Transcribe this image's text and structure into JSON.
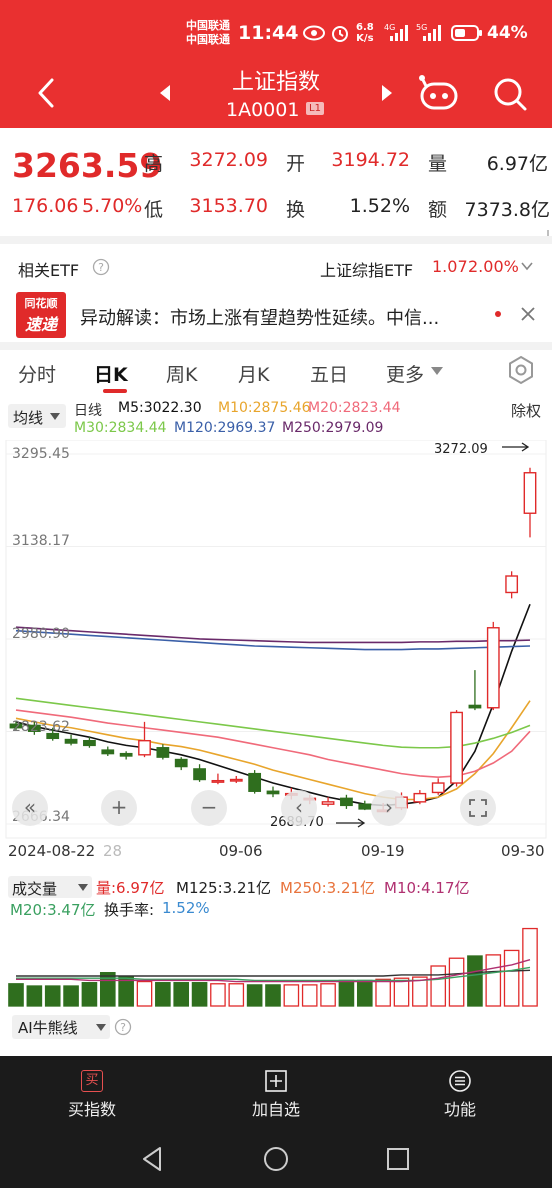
{
  "status_bar": {
    "carrier1": "中国联通",
    "carrier2": "中国联通",
    "time": "11:44",
    "net_speed_top": "6.8",
    "net_speed_bottom": "K/s",
    "battery": "44%"
  },
  "header": {
    "title": "上证指数",
    "code": "1A0001",
    "badge": "L1"
  },
  "quote": {
    "price": "3263.59",
    "change": "176.06",
    "change_pct": "5.70%",
    "high_label": "高",
    "high": "3272.09",
    "open_label": "开",
    "open": "3194.72",
    "volume_label": "量",
    "volume": "6.97亿",
    "low_label": "低",
    "low": "3153.70",
    "turnover_label": "换",
    "turnover": "1.52%",
    "amount_label": "额",
    "amount": "7373.8亿"
  },
  "etf": {
    "label": "相关ETF",
    "name": "上证综指ETF",
    "price": "1.07",
    "pct": "2.00%"
  },
  "news": {
    "logo_top": "同花顺",
    "logo_bottom": "速递",
    "text": "异动解读：市场上涨有望趋势性延续。中信..."
  },
  "tabs": [
    "分时",
    "日K",
    "周K",
    "月K",
    "五日",
    "更多"
  ],
  "chart_header": {
    "ma_select": "均线",
    "period": "日线",
    "m5": "M5:3022.30",
    "m10": "M10:2875.46",
    "m20": "M20:2823.44",
    "m30": "M30:2834.44",
    "m120": "M120:2969.37",
    "m250": "M250:2979.09",
    "adjust": "除权"
  },
  "volume_header": {
    "select": "成交量",
    "vol": "量:6.97亿",
    "m125": "M125:3.21亿",
    "m250": "M250:3.21亿",
    "m10": "M10:4.17亿",
    "m20": "M20:3.47亿",
    "turnover_label": "换手率:",
    "turnover": "1.52%"
  },
  "ai_label": "AI牛熊线",
  "bottom_bar": {
    "buy": "买指数",
    "add": "加自选",
    "func": "功能",
    "buy_icon_char": "买"
  },
  "colors": {
    "red": "#e02a2a",
    "green": "#2f6e1e",
    "m5": "#111111",
    "m10": "#e8a52c",
    "m20": "#f06a7a",
    "m30": "#7cc84a",
    "m120": "#3a5fa8",
    "m250": "#6a2a6a"
  },
  "chart_data": {
    "type": "candlestick",
    "y_ticks": [
      "3295.45",
      "3138.17",
      "2980.90",
      "2823.62",
      "2666.34"
    ],
    "ylim": [
      2666.34,
      3295.45
    ],
    "x_ticks": [
      "2024-08-22",
      "09-06",
      "09-19",
      "09-30"
    ],
    "x_tick_partial": "28",
    "annotations": {
      "high_label": "3272.09",
      "low_label": "2689.70"
    },
    "candles": [
      {
        "o": 2836,
        "c": 2830,
        "h": 2842,
        "l": 2826
      },
      {
        "o": 2834,
        "c": 2824,
        "h": 2840,
        "l": 2818
      },
      {
        "o": 2820,
        "c": 2812,
        "h": 2830,
        "l": 2808
      },
      {
        "o": 2810,
        "c": 2804,
        "h": 2818,
        "l": 2800
      },
      {
        "o": 2808,
        "c": 2800,
        "h": 2814,
        "l": 2796
      },
      {
        "o": 2792,
        "c": 2786,
        "h": 2798,
        "l": 2782
      },
      {
        "o": 2786,
        "c": 2782,
        "h": 2790,
        "l": 2776
      },
      {
        "o": 2784,
        "c": 2808,
        "h": 2840,
        "l": 2780
      },
      {
        "o": 2796,
        "c": 2780,
        "h": 2802,
        "l": 2776
      },
      {
        "o": 2776,
        "c": 2764,
        "h": 2780,
        "l": 2758
      },
      {
        "o": 2760,
        "c": 2742,
        "h": 2768,
        "l": 2738
      },
      {
        "o": 2740,
        "c": 2740,
        "h": 2752,
        "l": 2734
      },
      {
        "o": 2742,
        "c": 2742,
        "h": 2748,
        "l": 2736
      },
      {
        "o": 2752,
        "c": 2722,
        "h": 2758,
        "l": 2718
      },
      {
        "o": 2722,
        "c": 2718,
        "h": 2730,
        "l": 2712
      },
      {
        "o": 2718,
        "c": 2718,
        "h": 2728,
        "l": 2708
      },
      {
        "o": 2708,
        "c": 2710,
        "h": 2716,
        "l": 2700
      },
      {
        "o": 2700,
        "c": 2704,
        "h": 2712,
        "l": 2696
      },
      {
        "o": 2710,
        "c": 2698,
        "h": 2716,
        "l": 2692
      },
      {
        "o": 2700,
        "c": 2692,
        "h": 2706,
        "l": 2690
      },
      {
        "o": 2690,
        "c": 2690,
        "h": 2702,
        "l": 2689.7
      },
      {
        "o": 2694,
        "c": 2712,
        "h": 2720,
        "l": 2690
      },
      {
        "o": 2704,
        "c": 2718,
        "h": 2724,
        "l": 2700
      },
      {
        "o": 2720,
        "c": 2736,
        "h": 2744,
        "l": 2716
      },
      {
        "o": 2736,
        "c": 2856,
        "h": 2860,
        "l": 2730
      },
      {
        "o": 2868,
        "c": 2864,
        "h": 2928,
        "l": 2860
      },
      {
        "o": 2864,
        "c": 3000,
        "h": 3010,
        "l": 2860
      },
      {
        "o": 3060,
        "c": 3088,
        "h": 3096,
        "l": 3050
      },
      {
        "o": 3194.72,
        "c": 3263.59,
        "h": 3272.09,
        "l": 3153.7
      }
    ],
    "ma_series": [
      {
        "name": "M5",
        "values": [
          2840,
          2832,
          2826,
          2820,
          2814,
          2806,
          2800,
          2796,
          2790,
          2784,
          2776,
          2766,
          2756,
          2746,
          2736,
          2728,
          2720,
          2712,
          2706,
          2700,
          2698,
          2700,
          2704,
          2712,
          2740,
          2790,
          2870,
          2960,
          3040
        ]
      },
      {
        "name": "M10",
        "values": [
          2846,
          2840,
          2834,
          2830,
          2824,
          2818,
          2812,
          2808,
          2802,
          2798,
          2792,
          2784,
          2776,
          2768,
          2758,
          2750,
          2742,
          2734,
          2726,
          2718,
          2712,
          2708,
          2708,
          2712,
          2726,
          2752,
          2786,
          2830,
          2876
        ]
      },
      {
        "name": "M20",
        "values": [
          2860,
          2856,
          2852,
          2848,
          2843,
          2838,
          2834,
          2830,
          2826,
          2822,
          2818,
          2814,
          2808,
          2802,
          2796,
          2790,
          2784,
          2776,
          2770,
          2764,
          2758,
          2752,
          2748,
          2746,
          2748,
          2756,
          2770,
          2790,
          2824
        ]
      },
      {
        "name": "M30",
        "values": [
          2880,
          2876,
          2872,
          2868,
          2864,
          2860,
          2856,
          2852,
          2848,
          2844,
          2840,
          2836,
          2832,
          2828,
          2824,
          2820,
          2816,
          2812,
          2808,
          2804,
          2800,
          2797,
          2796,
          2796,
          2798,
          2804,
          2812,
          2822,
          2834
        ]
      },
      {
        "name": "M120",
        "values": [
          2995,
          2993,
          2991,
          2989,
          2987,
          2985,
          2983,
          2981,
          2979,
          2977,
          2975,
          2973,
          2971,
          2969,
          2968,
          2967,
          2966,
          2965,
          2964,
          2963,
          2963,
          2963,
          2964,
          2964,
          2965,
          2966,
          2967,
          2968,
          2969
        ]
      },
      {
        "name": "M250",
        "values": [
          3001,
          2999,
          2997,
          2995,
          2993,
          2991,
          2989,
          2987,
          2985,
          2983,
          2981,
          2980,
          2979,
          2978,
          2977,
          2976,
          2975,
          2975,
          2975,
          2975,
          2975,
          2975,
          2976,
          2976,
          2977,
          2977,
          2978,
          2978,
          2979
        ]
      }
    ],
    "volume": {
      "ylim": [
        0,
        7.2
      ],
      "values": [
        2.0,
        1.8,
        1.8,
        1.8,
        2.1,
        3.0,
        2.6,
        2.2,
        2.1,
        2.1,
        2.1,
        2.0,
        2.0,
        1.9,
        1.9,
        1.9,
        1.9,
        2.0,
        2.3,
        2.3,
        2.4,
        2.5,
        2.6,
        3.6,
        4.3,
        4.5,
        4.6,
        5.0,
        6.97
      ],
      "m10": [
        2.4,
        2.4,
        2.4,
        2.4,
        2.3,
        2.3,
        2.3,
        2.3,
        2.3,
        2.3,
        2.3,
        2.3,
        2.2,
        2.2,
        2.2,
        2.2,
        2.2,
        2.2,
        2.2,
        2.2,
        2.2,
        2.2,
        2.3,
        2.5,
        2.8,
        3.1,
        3.4,
        3.7,
        4.17
      ],
      "m20": [
        2.5,
        2.5,
        2.5,
        2.5,
        2.5,
        2.5,
        2.5,
        2.4,
        2.4,
        2.4,
        2.4,
        2.4,
        2.4,
        2.3,
        2.3,
        2.3,
        2.3,
        2.3,
        2.3,
        2.3,
        2.3,
        2.3,
        2.3,
        2.4,
        2.6,
        2.8,
        3.0,
        3.2,
        3.47
      ],
      "m125": [
        2.7,
        2.7,
        2.7,
        2.7,
        2.7,
        2.7,
        2.7,
        2.7,
        2.7,
        2.7,
        2.7,
        2.7,
        2.7,
        2.7,
        2.7,
        2.7,
        2.7,
        2.7,
        2.7,
        2.7,
        2.7,
        2.8,
        2.8,
        2.8,
        2.9,
        3.0,
        3.1,
        3.15,
        3.21
      ]
    }
  }
}
